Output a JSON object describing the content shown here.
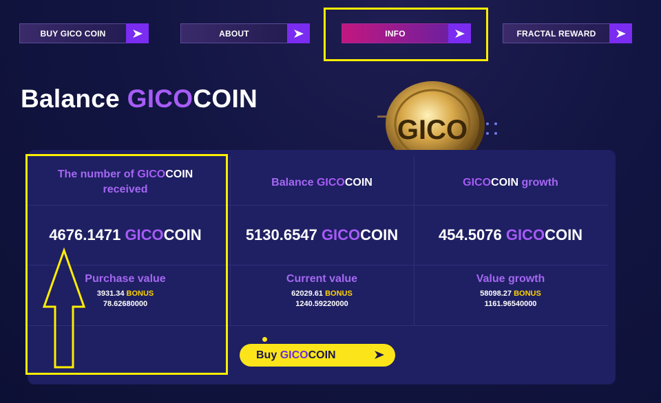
{
  "nav": [
    {
      "label": "BUY GICO COIN"
    },
    {
      "label": "ABOUT"
    },
    {
      "label": "INFO"
    },
    {
      "label": "FRACTAL REWARD"
    }
  ],
  "brand": {
    "gico": "GICO",
    "coin": "COIN"
  },
  "title": {
    "prefix": "Balance"
  },
  "coin_image": {
    "text": "GICO"
  },
  "columns": [
    {
      "heading_prefix": "The number of",
      "heading_suffix": "received",
      "amount": "4676.1471",
      "sub_title": "Purchase value",
      "value": "3931.34",
      "bonus_label": "BONUS",
      "secondary": "78.62680000"
    },
    {
      "heading_prefix": "Balance",
      "heading_suffix": "",
      "amount": "5130.6547",
      "sub_title": "Current value",
      "value": "62029.61",
      "bonus_label": "BONUS",
      "secondary": "1240.59220000"
    },
    {
      "heading_prefix": "",
      "heading_suffix": "growth",
      "amount": "454.5076",
      "sub_title": "Value growth",
      "value": "58098.27",
      "bonus_label": "BONUS",
      "secondary": "1161.96540000"
    }
  ],
  "buy_button": {
    "prefix": "Buy"
  },
  "colors": {
    "accent": "#a65cf5",
    "highlight": "#ffee00",
    "button": "#fbe51a",
    "panel": "#1f1f63"
  },
  "icons": [
    "arrow-right-icon",
    "up-arrow-annotation-icon"
  ]
}
